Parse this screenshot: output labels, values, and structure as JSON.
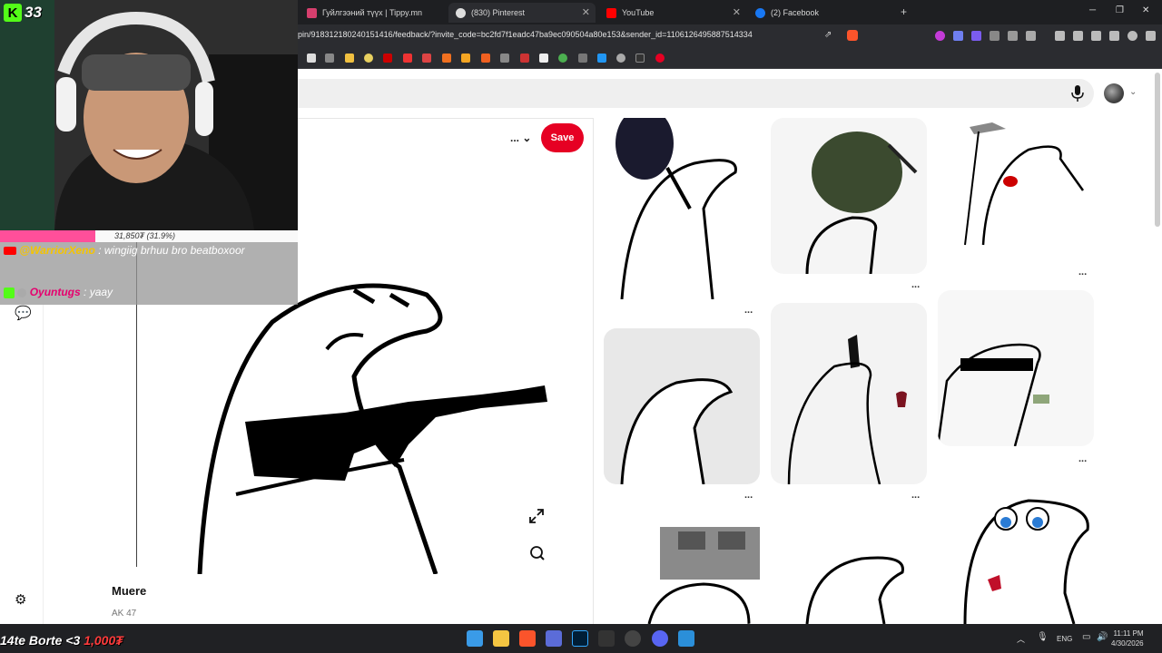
{
  "browser": {
    "tabs": [
      {
        "title": "Гуйлгээний түүх | Tippy.mn",
        "icon": "tippy-favicon"
      },
      {
        "title": "(830) Pinterest",
        "icon": "pinterest-favicon"
      },
      {
        "title": "YouTube",
        "icon": "youtube-favicon"
      },
      {
        "title": "(2) Facebook",
        "icon": "facebook-favicon"
      }
    ],
    "new_tab": "+",
    "url": "pin/918312180240151416/feedback/?invite_code=bc2fd7f1eadc47ba9ec090504a80e153&sender_id=1106126495887514334"
  },
  "pinterest": {
    "save_label": "Save",
    "more_label": "... ⌄",
    "pin_title": "Muere",
    "pin_description": "AK 47",
    "tile_menu": "..."
  },
  "stream": {
    "viewer_count": "33",
    "goal_text": "31,850₮ (31.9%)",
    "goal_fraction": 0.319,
    "chat": [
      {
        "name": "@WarriorXeno",
        "message": ": wingiig brhuu bro beatboxoor"
      },
      {
        "name": "Oyuntugs",
        "message": ": yaay"
      }
    ],
    "bottom_text": "14te Borte <3 ",
    "bottom_amount": "1,000₮"
  },
  "system": {
    "language": "ENG",
    "time": "11:11 PM",
    "date": "4/30/2026"
  },
  "colors": {
    "pinterest_red": "#e60023",
    "kick_green": "#53fc18",
    "goal_pink": "#ff4f9a"
  }
}
